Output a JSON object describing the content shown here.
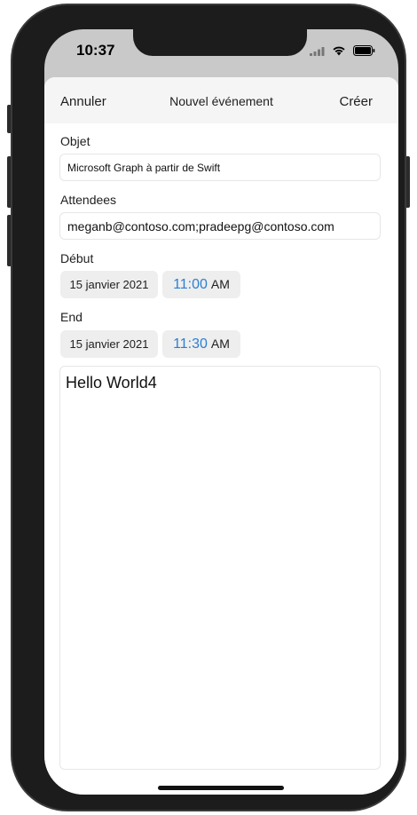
{
  "status_bar": {
    "time": "10:37"
  },
  "nav": {
    "cancel_label": "Annuler",
    "title": "Nouvel événement",
    "create_label": "Créer"
  },
  "form": {
    "subject_label": "Objet",
    "subject_value": "Microsoft Graph à partir de Swift",
    "attendees_label": "Attendees",
    "attendees_value": "meganb@contoso.com;pradeepg@contoso.com",
    "start_label": "Début",
    "start_date": "15 janvier 2021",
    "start_time": "11:00",
    "start_ampm": "AM",
    "end_label": "End",
    "end_date": "15 janvier 2021",
    "end_time": "11:30",
    "end_ampm": "AM",
    "body_text": "Hello World4"
  },
  "colors": {
    "accent": "#2a7fd4",
    "nav_background": "#f5f5f5",
    "device_frame": "#1c1c1c"
  },
  "icons": [
    "signal-icon",
    "wifi-icon",
    "battery-icon"
  ]
}
